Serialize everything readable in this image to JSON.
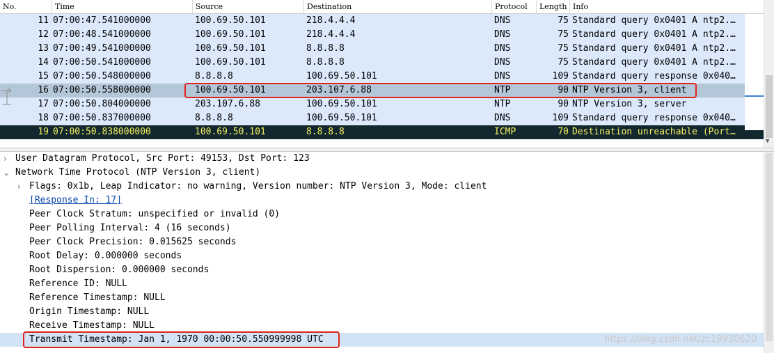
{
  "columns": {
    "no": "No.",
    "time": "Time",
    "source": "Source",
    "destination": "Destination",
    "protocol": "Protocol",
    "length": "Length",
    "info": "Info"
  },
  "packets": [
    {
      "no": "11",
      "time": "07:00:47.541000000",
      "source": "100.69.50.101",
      "destination": "218.4.4.4",
      "protocol": "DNS",
      "length": "75",
      "info": "Standard query 0x0401 A ntp2.…"
    },
    {
      "no": "12",
      "time": "07:00:48.541000000",
      "source": "100.69.50.101",
      "destination": "218.4.4.4",
      "protocol": "DNS",
      "length": "75",
      "info": "Standard query 0x0401 A ntp2.…"
    },
    {
      "no": "13",
      "time": "07:00:49.541000000",
      "source": "100.69.50.101",
      "destination": "8.8.8.8",
      "protocol": "DNS",
      "length": "75",
      "info": "Standard query 0x0401 A ntp2.…"
    },
    {
      "no": "14",
      "time": "07:00:50.541000000",
      "source": "100.69.50.101",
      "destination": "8.8.8.8",
      "protocol": "DNS",
      "length": "75",
      "info": "Standard query 0x0401 A ntp2.…"
    },
    {
      "no": "15",
      "time": "07:00:50.548000000",
      "source": "8.8.8.8",
      "destination": "100.69.50.101",
      "protocol": "DNS",
      "length": "109",
      "info": "Standard query response 0x040…"
    },
    {
      "no": "16",
      "time": "07:00:50.558000000",
      "source": "100.69.50.101",
      "destination": "203.107.6.88",
      "protocol": "NTP",
      "length": "90",
      "info": "NTP Version 3, client"
    },
    {
      "no": "17",
      "time": "07:00:50.804000000",
      "source": "203.107.6.88",
      "destination": "100.69.50.101",
      "protocol": "NTP",
      "length": "90",
      "info": "NTP Version 3, server"
    },
    {
      "no": "18",
      "time": "07:00:50.837000000",
      "source": "8.8.8.8",
      "destination": "100.69.50.101",
      "protocol": "DNS",
      "length": "109",
      "info": "Standard query response 0x040…"
    },
    {
      "no": "19",
      "time": "07:00:50.838000000",
      "source": "100.69.50.101",
      "destination": "8.8.8.8",
      "protocol": "ICMP",
      "length": "70",
      "info": "Destination unreachable (Port…"
    }
  ],
  "details": {
    "udp": "User Datagram Protocol, Src Port: 49153, Dst Port: 123",
    "ntp": "Network Time Protocol (NTP Version 3, client)",
    "flags": "Flags: 0x1b, Leap Indicator: no warning, Version number: NTP Version 3, Mode: client",
    "response_in": "[Response In: 17]",
    "stratum": "Peer Clock Stratum: unspecified or invalid (0)",
    "polling": "Peer Polling Interval: 4 (16 seconds)",
    "precision": "Peer Clock Precision: 0.015625 seconds",
    "root_delay": "Root Delay: 0.000000 seconds",
    "root_dispersion": "Root Dispersion: 0.000000 seconds",
    "reference_id": "Reference ID: NULL",
    "reference_ts": "Reference Timestamp: NULL",
    "origin_ts": "Origin Timestamp: NULL",
    "receive_ts": "Receive Timestamp: NULL",
    "transmit_ts": "Transmit Timestamp: Jan  1, 1970 00:00:50.550999998 UTC"
  },
  "watermark": "https://blog.csdn.net/zc19930620"
}
